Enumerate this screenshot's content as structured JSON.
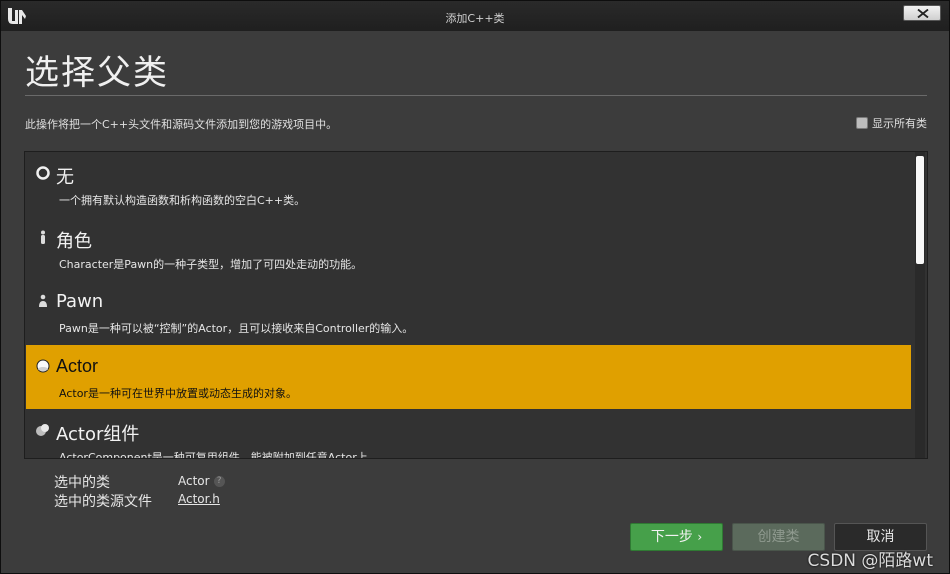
{
  "window": {
    "title": "添加C++类",
    "close_icon": "close-icon"
  },
  "header": {
    "title": "选择父类",
    "description": "此操作将把一个C++头文件和源码文件添加到您的游戏项目中。",
    "show_all_label": "显示所有类"
  },
  "classes": [
    {
      "name": "无",
      "description": "一个拥有默认构造函数和析构函数的空白C++类。",
      "icon": "none-class-icon"
    },
    {
      "name": "角色",
      "description": "Character是Pawn的一种子类型，增加了可四处走动的功能。",
      "icon": "character-icon"
    },
    {
      "name": "Pawn",
      "description": "Pawn是一种可以被“控制”的Actor，且可以接收来自Controller的输入。",
      "icon": "pawn-icon"
    },
    {
      "name": "Actor",
      "description": "Actor是一种可在世界中放置或动态生成的对象。",
      "icon": "actor-icon",
      "selected": true
    },
    {
      "name": "Actor组件",
      "description": "ActorComponent是一种可复用组件，能被附加到任意Actor上",
      "icon": "actor-component-icon"
    }
  ],
  "selection": {
    "class_label": "选中的类",
    "class_value": "Actor",
    "source_label": "选中的类源文件",
    "source_value": "Actor.h"
  },
  "buttons": {
    "next": "下一步",
    "create": "创建类",
    "cancel": "取消"
  },
  "watermark": "CSDN @陌路wt",
  "colors": {
    "selected_bg": "#e0a000",
    "next_button": "#46a04a",
    "window_bg": "#3c3c3c"
  }
}
